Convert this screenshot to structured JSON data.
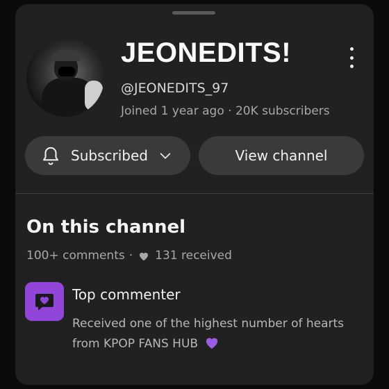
{
  "channel": {
    "name": "JEONEDITS!",
    "handle": "@JEONEDITS_97",
    "joined": "Joined 1 year ago",
    "separator": "·",
    "subscribers": "20K subscribers"
  },
  "buttons": {
    "subscribed_label": "Subscribed",
    "view_channel_label": "View channel"
  },
  "section": {
    "title": "On this channel",
    "comments": "100+ comments",
    "separator": "·",
    "hearts_received": "131 received"
  },
  "award": {
    "title": "Top commenter",
    "description": "Received one of the highest number of hearts from KPOP FANS HUB"
  },
  "icons": {
    "more": "more-vert-icon",
    "bell": "bell-icon",
    "chevron": "chevron-down-icon",
    "heart": "heart-icon",
    "badge": "chat-heart-icon",
    "purple_heart": "purple-heart-icon"
  },
  "colors": {
    "background": "#0b0b0b",
    "sheet": "#212121",
    "button": "#3a3a3a",
    "badge": "#9146d9",
    "purple_heart": "#9b5de5"
  }
}
